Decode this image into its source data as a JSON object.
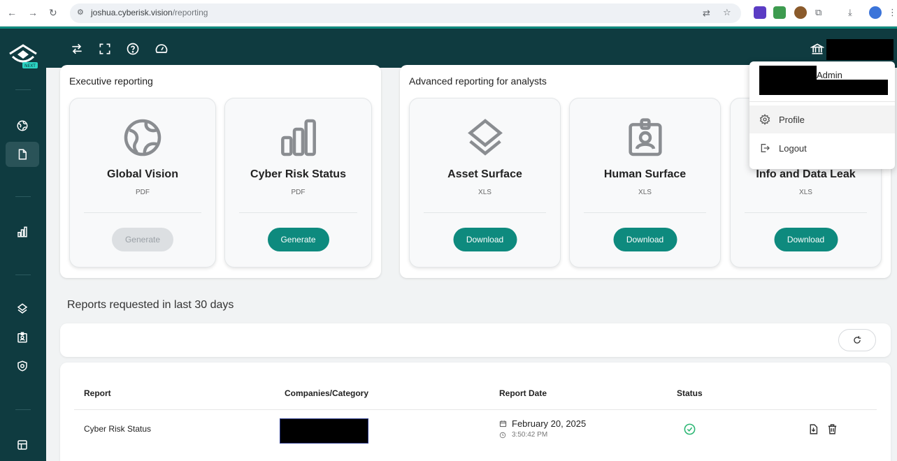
{
  "browser": {
    "url_host": "joshua.cyberisk.vision",
    "url_path": "/reporting"
  },
  "colors": {
    "primary": "#0e8a7e",
    "dark": "#0f3b40",
    "success": "#2bb673"
  },
  "sidebar": {
    "items": [
      {
        "icon": "globe-icon"
      },
      {
        "icon": "document-icon",
        "active": true
      },
      {
        "icon": "bar-chart-icon"
      },
      {
        "icon": "layers-icon"
      },
      {
        "icon": "badge-icon"
      },
      {
        "icon": "shield-icon"
      },
      {
        "icon": "grid-icon"
      }
    ],
    "logo_badge": "NEXT"
  },
  "topbar": {
    "icons": [
      "swap-icon",
      "fullscreen-icon",
      "help-icon",
      "gauge-icon"
    ]
  },
  "user_menu": {
    "role": "Admin",
    "items": [
      {
        "label": "Profile",
        "icon": "gear-icon"
      },
      {
        "label": "Logout",
        "icon": "logout-icon"
      }
    ]
  },
  "executive": {
    "title": "Executive reporting",
    "cards": [
      {
        "title": "Global Vision",
        "format": "PDF",
        "button": "Generate",
        "disabled": true,
        "icon": "globe-icon"
      },
      {
        "title": "Cyber Risk Status",
        "format": "PDF",
        "button": "Generate",
        "disabled": false,
        "icon": "bar-chart-icon"
      }
    ]
  },
  "advanced": {
    "title": "Advanced reporting for analysts",
    "cards": [
      {
        "title": "Asset Surface",
        "format": "XLS",
        "button": "Download",
        "icon": "layers-icon"
      },
      {
        "title": "Human Surface",
        "format": "XLS",
        "button": "Download",
        "icon": "badge-icon"
      },
      {
        "title": "Info and Data Leak",
        "format": "XLS",
        "button": "Download",
        "icon": "shield-icon"
      }
    ]
  },
  "reports": {
    "title": "Reports requested in last 30 days",
    "columns": [
      "Report",
      "Companies/Category",
      "Report Date",
      "Status"
    ],
    "rows": [
      {
        "report": "Cyber Risk Status",
        "date": "February 20, 2025",
        "time": "3:50:42 PM",
        "status": "completed"
      }
    ]
  }
}
